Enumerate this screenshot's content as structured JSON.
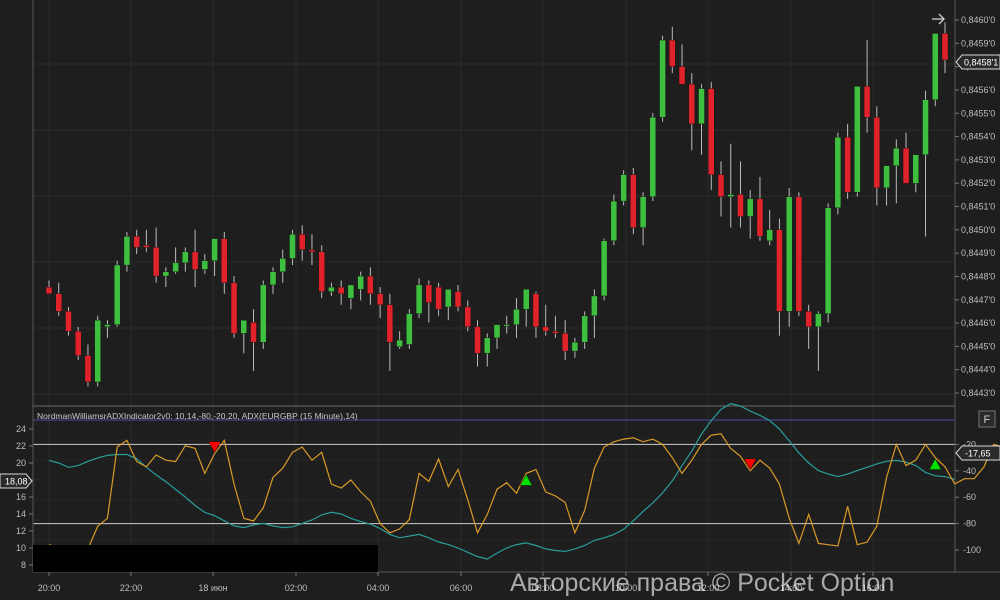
{
  "chart_data": [
    {
      "type": "candlestick",
      "symbol": "EURGBP",
      "timeframe": "15 Minute",
      "y_ticks": [
        "0,8460'0",
        "0,8459'0",
        "0,8457'0",
        "0,8456'0",
        "0,8455'0",
        "0,8454'0",
        "0,8453'0",
        "0,8452'0",
        "0,8451'0",
        "0,8450'0",
        "0,8449'0",
        "0,8448'0",
        "0,8447'0",
        "0,8446'0",
        "0,8445'0",
        "0,8444'0",
        "0,8443'0"
      ],
      "current_price_label": "0,8458'1",
      "current_price": 0.84581,
      "colors": {
        "up": "#3fbf3f",
        "down": "#e0222b",
        "background": "#1e1e1e",
        "grid": "#2e2e2e"
      },
      "candles": [
        [
          0.84478,
          0.84481,
          0.84475,
          0.84475
        ],
        [
          0.84475,
          0.8448,
          0.84465,
          0.84467
        ],
        [
          0.84467,
          0.84469,
          0.84456,
          0.84458
        ],
        [
          0.84458,
          0.8446,
          0.84445,
          0.84447
        ],
        [
          0.84447,
          0.84452,
          0.84433,
          0.84435
        ],
        [
          0.84435,
          0.84465,
          0.84433,
          0.84463
        ],
        [
          0.8446,
          0.84463,
          0.84455,
          0.84461
        ],
        [
          0.84461,
          0.8449,
          0.8446,
          0.84488
        ],
        [
          0.84488,
          0.84503,
          0.84485,
          0.84501
        ],
        [
          0.84501,
          0.84504,
          0.84493,
          0.84496
        ],
        [
          0.84497,
          0.84504,
          0.84494,
          0.84496
        ],
        [
          0.84496,
          0.84505,
          0.8448,
          0.84483
        ],
        [
          0.84483,
          0.84487,
          0.84478,
          0.84485
        ],
        [
          0.84485,
          0.84496,
          0.84484,
          0.84489
        ],
        [
          0.84489,
          0.84496,
          0.84485,
          0.84494
        ],
        [
          0.84494,
          0.84504,
          0.84478,
          0.84486
        ],
        [
          0.84486,
          0.84493,
          0.84484,
          0.8449
        ],
        [
          0.8449,
          0.84498,
          0.84483,
          0.845
        ],
        [
          0.845,
          0.84503,
          0.84475,
          0.8448
        ],
        [
          0.8448,
          0.84483,
          0.84455,
          0.84457
        ],
        [
          0.84457,
          0.84462,
          0.84448,
          0.84463
        ],
        [
          0.84462,
          0.84468,
          0.8444,
          0.84453
        ],
        [
          0.84453,
          0.84481,
          0.8445,
          0.84479
        ],
        [
          0.84479,
          0.84487,
          0.84475,
          0.84485
        ],
        [
          0.84485,
          0.84495,
          0.8448,
          0.84491
        ],
        [
          0.84491,
          0.84504,
          0.84488,
          0.84502
        ],
        [
          0.84502,
          0.84506,
          0.8449,
          0.84495
        ],
        [
          0.84495,
          0.84502,
          0.84488,
          0.84494
        ],
        [
          0.84494,
          0.84497,
          0.84473,
          0.84476
        ],
        [
          0.84476,
          0.8448,
          0.84474,
          0.84478
        ],
        [
          0.84478,
          0.84481,
          0.8447,
          0.84475
        ],
        [
          0.84473,
          0.84479,
          0.84468,
          0.84479
        ],
        [
          0.84477,
          0.84485,
          0.84472,
          0.84483
        ],
        [
          0.84483,
          0.84487,
          0.8447,
          0.84475
        ],
        [
          0.84475,
          0.84478,
          0.84464,
          0.8447
        ],
        [
          0.8447,
          0.84475,
          0.8444,
          0.84453
        ],
        [
          0.84451,
          0.84458,
          0.8445,
          0.84454
        ],
        [
          0.84452,
          0.84468,
          0.8445,
          0.84466
        ],
        [
          0.84466,
          0.84482,
          0.84464,
          0.84479
        ],
        [
          0.84479,
          0.84481,
          0.84462,
          0.84471
        ],
        [
          0.84478,
          0.8448,
          0.84465,
          0.84468
        ],
        [
          0.84469,
          0.84475,
          0.84463,
          0.84477
        ],
        [
          0.84476,
          0.84479,
          0.84467,
          0.84469
        ],
        [
          0.84469,
          0.84472,
          0.84458,
          0.8446
        ],
        [
          0.8446,
          0.84463,
          0.84442,
          0.84448
        ],
        [
          0.84448,
          0.84457,
          0.84442,
          0.84455
        ],
        [
          0.84455,
          0.84461,
          0.8445,
          0.84461
        ],
        [
          0.84461,
          0.84465,
          0.84457,
          0.84461
        ],
        [
          0.84461,
          0.84473,
          0.84455,
          0.84468
        ],
        [
          0.84468,
          0.84476,
          0.8446,
          0.84477
        ],
        [
          0.84475,
          0.84476,
          0.84455,
          0.8446
        ],
        [
          0.8446,
          0.8447,
          0.84456,
          0.84458
        ],
        [
          0.84458,
          0.84465,
          0.84455,
          0.84457
        ],
        [
          0.84457,
          0.84463,
          0.84445,
          0.84449
        ],
        [
          0.84449,
          0.84455,
          0.84446,
          0.84453
        ],
        [
          0.84453,
          0.84467,
          0.8445,
          0.84465
        ],
        [
          0.84465,
          0.84477,
          0.84455,
          0.84474
        ],
        [
          0.84474,
          0.845,
          0.84472,
          0.84499
        ],
        [
          0.84499,
          0.8452,
          0.84497,
          0.84517
        ],
        [
          0.84517,
          0.84531,
          0.84515,
          0.84529
        ],
        [
          0.84529,
          0.84532,
          0.84502,
          0.84505
        ],
        [
          0.84505,
          0.84521,
          0.84497,
          0.84519
        ],
        [
          0.84519,
          0.84557,
          0.84517,
          0.84555
        ],
        [
          0.84555,
          0.84592,
          0.84553,
          0.8459
        ],
        [
          0.8459,
          0.84596,
          0.84575,
          0.84578
        ],
        [
          0.84578,
          0.84588,
          0.8457,
          0.8457
        ],
        [
          0.8457,
          0.84575,
          0.8454,
          0.84552
        ],
        [
          0.84552,
          0.8457,
          0.84538,
          0.84568
        ],
        [
          0.84568,
          0.84571,
          0.84522,
          0.84529
        ],
        [
          0.84529,
          0.84535,
          0.8451,
          0.84519
        ],
        [
          0.84519,
          0.84543,
          0.84505,
          0.8452
        ],
        [
          0.8452,
          0.84535,
          0.84505,
          0.8451
        ],
        [
          0.8451,
          0.84522,
          0.845,
          0.84518
        ],
        [
          0.84518,
          0.84528,
          0.84499,
          0.84501
        ],
        [
          0.84499,
          0.84513,
          0.84497,
          0.84504
        ],
        [
          0.84504,
          0.84509,
          0.84456,
          0.84467
        ],
        [
          0.84467,
          0.84523,
          0.8446,
          0.84519
        ],
        [
          0.84519,
          0.84521,
          0.84465,
          0.84467
        ],
        [
          0.84467,
          0.8447,
          0.8445,
          0.8446
        ],
        [
          0.8446,
          0.84467,
          0.8444,
          0.84466
        ],
        [
          0.84466,
          0.84516,
          0.84462,
          0.84514
        ],
        [
          0.84514,
          0.84548,
          0.84511,
          0.84546
        ],
        [
          0.84546,
          0.84552,
          0.84518,
          0.84521
        ],
        [
          0.84521,
          0.84569,
          0.84519,
          0.84569
        ],
        [
          0.84569,
          0.8459,
          0.84548,
          0.84555
        ],
        [
          0.84555,
          0.8456,
          0.84515,
          0.84523
        ],
        [
          0.84523,
          0.8453,
          0.84515,
          0.84533
        ],
        [
          0.84533,
          0.84545,
          0.84516,
          0.84541
        ],
        [
          0.84541,
          0.84548,
          0.84526,
          0.84525
        ],
        [
          0.84525,
          0.84537,
          0.84521,
          0.84538
        ],
        [
          0.84538,
          0.84567,
          0.84501,
          0.84563
        ],
        [
          0.84563,
          0.84592,
          0.8456,
          0.84593
        ],
        [
          0.84593,
          0.84598,
          0.84575,
          0.84581
        ]
      ]
    },
    {
      "type": "line",
      "title": "NordmanWilliamsrADXIndicator2v0: 10,14,-80,-20,20, ADX(EURGBP (15 Minute),14)",
      "y_ticks_left": [
        "24",
        "22",
        "20",
        "18",
        "16",
        "14",
        "12",
        "10",
        "8"
      ],
      "y_ticks_right": [
        "-20",
        "-40",
        "-60",
        "-80",
        "-100"
      ],
      "x_ticks": [
        "20:00",
        "22:00",
        "18 июн",
        "02:00",
        "04:00",
        "06:00",
        "08:00",
        "10:00",
        "12:00",
        "14:00",
        "16:00"
      ],
      "levels_right": [
        -20,
        -80
      ],
      "current_adx_label": "18,08",
      "current_adx": 18.08,
      "current_wpr_label": "-17,65",
      "current_wpr": -17.65,
      "series": [
        {
          "key": "adx",
          "color": "#2a9d9a",
          "values": [
            20.3,
            20.0,
            19.5,
            19.7,
            20.2,
            20.6,
            20.9,
            21.0,
            21.0,
            20.5,
            19.5,
            18.6,
            17.8,
            16.9,
            16.0,
            15.0,
            14.2,
            13.8,
            13.2,
            12.6,
            12.4,
            12.7,
            12.9,
            12.6,
            12.4,
            12.5,
            12.9,
            13.3,
            13.9,
            14.2,
            14.0,
            13.5,
            13.1,
            12.8,
            12.3,
            11.6,
            11.2,
            11.4,
            11.6,
            11.2,
            10.7,
            10.4,
            10.0,
            9.5,
            9.0,
            8.7,
            9.4,
            10.0,
            10.4,
            10.6,
            10.3,
            9.9,
            9.7,
            9.6,
            9.9,
            10.3,
            10.9,
            11.2,
            11.6,
            12.2,
            13.2,
            14.3,
            15.3,
            16.5,
            17.9,
            19.7,
            21.4,
            23.4,
            25.0,
            26.3,
            27.0,
            26.7,
            26.1,
            25.6,
            25.0,
            24.0,
            22.6,
            21.2,
            20.0,
            19.1,
            18.7,
            18.4,
            18.7,
            19.1,
            19.5,
            19.9,
            20.2,
            20.3,
            20.1,
            19.7,
            18.9,
            18.5,
            18.4,
            18.08
          ]
        },
        {
          "key": "wpr",
          "color": "#d99a27",
          "values": [
            -96,
            -98,
            -99,
            -97,
            -99,
            -82,
            -76,
            -22,
            -17,
            -33,
            -37,
            -28,
            -32,
            -33,
            -21,
            -23,
            -42,
            -27,
            -17,
            -50,
            -76,
            -78,
            -68,
            -45,
            -38,
            -26,
            -22,
            -32,
            -26,
            -50,
            -53,
            -47,
            -56,
            -63,
            -80,
            -87,
            -84,
            -77,
            -42,
            -48,
            -31,
            -52,
            -39,
            -62,
            -87,
            -73,
            -54,
            -49,
            -57,
            -42,
            -39,
            -56,
            -59,
            -64,
            -87,
            -70,
            -38,
            -22,
            -18,
            -16,
            -15,
            -18,
            -16,
            -20,
            -30,
            -42,
            -32,
            -20,
            -13,
            -12,
            -23,
            -29,
            -40,
            -32,
            -38,
            -50,
            -76,
            -95,
            -73,
            -95,
            -96,
            -97,
            -67,
            -96,
            -94,
            -82,
            -45,
            -20,
            -36,
            -32,
            -20,
            -30,
            -37,
            -50,
            -46,
            -46,
            -37,
            -20,
            -22
          ]
        }
      ],
      "signals": [
        {
          "index": 17,
          "direction": "down",
          "color": "#ff0000"
        },
        {
          "index": 49,
          "direction": "up",
          "color": "#00e000"
        },
        {
          "index": 72,
          "direction": "down",
          "color": "#ff0000"
        },
        {
          "index": 91,
          "direction": "up",
          "color": "#00e000"
        }
      ]
    }
  ],
  "side_button_label": "F",
  "watermark": "Авторские права © Pocket Option"
}
